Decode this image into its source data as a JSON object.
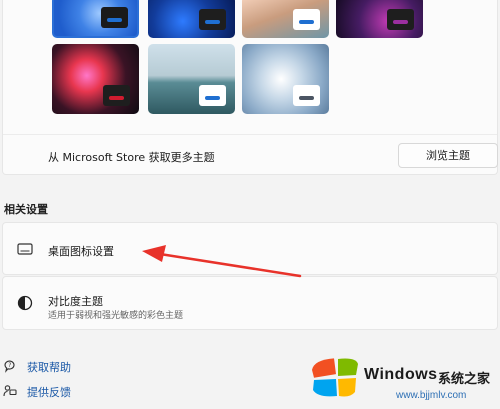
{
  "store_row": {
    "label": "从 Microsoft Store 获取更多主题",
    "button_label": "浏览主题"
  },
  "related": {
    "section_title": "相关设置",
    "desktop_icons": {
      "title": "桌面图标设置"
    },
    "contrast": {
      "title": "对比度主题",
      "subtitle": "适用于弱视和强光敏感的彩色主题"
    }
  },
  "links": {
    "help": "获取帮助",
    "feedback": "提供反馈"
  },
  "themes": [
    {
      "name": "theme-1",
      "chip_color": "#1f6fd1",
      "selected": true
    },
    {
      "name": "theme-2",
      "chip_color": "#1f6fd1"
    },
    {
      "name": "theme-3",
      "chip_color": "#1f6fd1"
    },
    {
      "name": "theme-4",
      "chip_color": "#9b2f9f"
    },
    {
      "name": "theme-5",
      "chip_color": "#d11c2f"
    },
    {
      "name": "theme-6",
      "chip_color": "#1f6fd1"
    },
    {
      "name": "theme-7",
      "chip_color": "#4b5563"
    }
  ],
  "watermark": {
    "brand": "Windows",
    "cn": "系统之家",
    "url": "www.bjjmlv.com"
  },
  "colors": {
    "accent": "#1957a6",
    "annotation_arrow": "#e8322a"
  }
}
